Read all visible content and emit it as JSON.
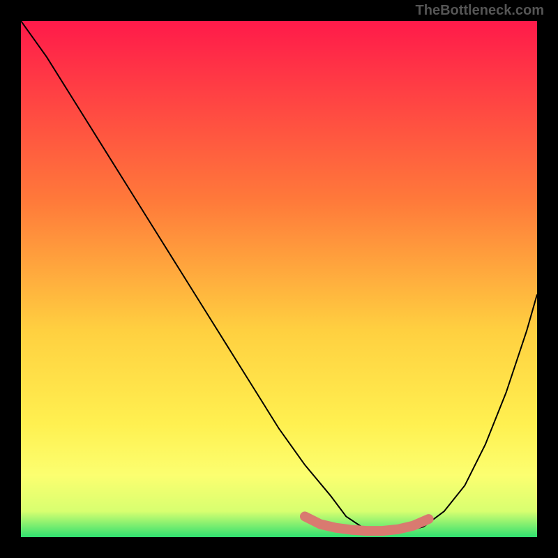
{
  "attribution": "TheBottleneck.com",
  "chart_data": {
    "type": "line",
    "title": "",
    "xlabel": "",
    "ylabel": "",
    "xlim": [
      0,
      100
    ],
    "ylim": [
      0,
      100
    ],
    "gradient_stops": [
      {
        "offset": 0,
        "color": "#ff1a4a"
      },
      {
        "offset": 35,
        "color": "#ff7a3a"
      },
      {
        "offset": 60,
        "color": "#ffd040"
      },
      {
        "offset": 78,
        "color": "#fff050"
      },
      {
        "offset": 88,
        "color": "#fcff70"
      },
      {
        "offset": 95,
        "color": "#d8ff70"
      },
      {
        "offset": 100,
        "color": "#30e070"
      }
    ],
    "series": [
      {
        "name": "bottleneck-curve",
        "x": [
          0,
          5,
          10,
          15,
          20,
          25,
          30,
          35,
          40,
          45,
          50,
          55,
          60,
          63,
          66,
          70,
          74,
          78,
          82,
          86,
          90,
          94,
          98,
          100
        ],
        "y": [
          100,
          93,
          85,
          77,
          69,
          61,
          53,
          45,
          37,
          29,
          21,
          14,
          8,
          4,
          2,
          1,
          1,
          2,
          5,
          10,
          18,
          28,
          40,
          47
        ]
      }
    ],
    "marker_band": {
      "name": "optimal-zone",
      "color": "#d97a70",
      "x": [
        55,
        58,
        61,
        64,
        67,
        70,
        73,
        76,
        79
      ],
      "y": [
        4.0,
        2.5,
        1.8,
        1.4,
        1.2,
        1.2,
        1.5,
        2.2,
        3.5
      ]
    }
  }
}
